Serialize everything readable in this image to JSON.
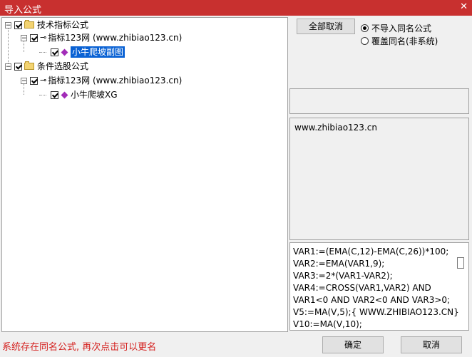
{
  "window": {
    "title": "导入公式",
    "close_glyph": "✕"
  },
  "tree": {
    "group1": {
      "label": "技术指标公式"
    },
    "site1": {
      "label": "指标123网 (www.zhibiao123.cn)"
    },
    "formula1": {
      "label": "小牛爬坡副图"
    },
    "group2": {
      "label": "条件选股公式"
    },
    "site2": {
      "label": "指标123网 (www.zhibiao123.cn)"
    },
    "formula2": {
      "label": "小牛爬坡XG"
    }
  },
  "buttons": {
    "cancel_all": "全部取消",
    "ok": "确定",
    "cancel": "取消"
  },
  "options": {
    "no_import_same": "不导入同名公式",
    "overwrite_same": "覆盖同名(非系统)",
    "selected": "no_import_same"
  },
  "info": {
    "description": "www.zhibiao123.cn"
  },
  "code": {
    "lines": [
      "VAR1:=(EMA(C,12)-EMA(C,26))*100;",
      "VAR2:=EMA(VAR1,9);",
      "VAR3:=2*(VAR1-VAR2);",
      "VAR4:=CROSS(VAR1,VAR2) AND",
      "VAR1<0 AND VAR2<0 AND VAR3>0;",
      "V5:=MA(V,5);{ WWW.ZHIBIAO123.CN}",
      "V10:=MA(V,10);"
    ]
  },
  "status": {
    "message": "系统存在同名公式, 再次点击可以更名"
  },
  "icons": {
    "expander_minus": "−",
    "key": "⊸"
  }
}
